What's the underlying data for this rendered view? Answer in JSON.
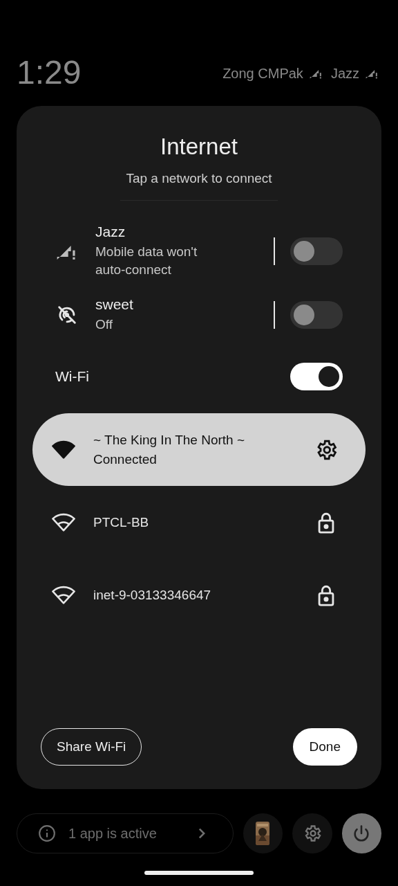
{
  "status_bar": {
    "time": "1:29",
    "carriers": [
      {
        "name": "Zong CMPak"
      },
      {
        "name": "Jazz"
      }
    ]
  },
  "dialog": {
    "title": "Internet",
    "subtitle": "Tap a network to connect",
    "mobile_networks": [
      {
        "name": "Jazz",
        "status": "Mobile data won't auto-connect",
        "kind": "signal",
        "on": false
      },
      {
        "name": "sweet",
        "status": "Off",
        "kind": "hotspot",
        "on": false
      }
    ],
    "wifi": {
      "label": "Wi-Fi",
      "on": true
    },
    "networks": [
      {
        "name": "~ The King In The North ~",
        "status": "Connected",
        "selected": true,
        "locked": false
      },
      {
        "name": "PTCL-BB",
        "selected": false,
        "locked": true
      },
      {
        "name": "inet-9-03133346647",
        "selected": false,
        "locked": true
      }
    ],
    "buttons": [
      {
        "label": "Share Wi-Fi",
        "kind": "outlined"
      },
      {
        "label": "Done",
        "kind": "filled"
      }
    ]
  },
  "bottom_bar": {
    "active_apps": "1 app is active"
  }
}
